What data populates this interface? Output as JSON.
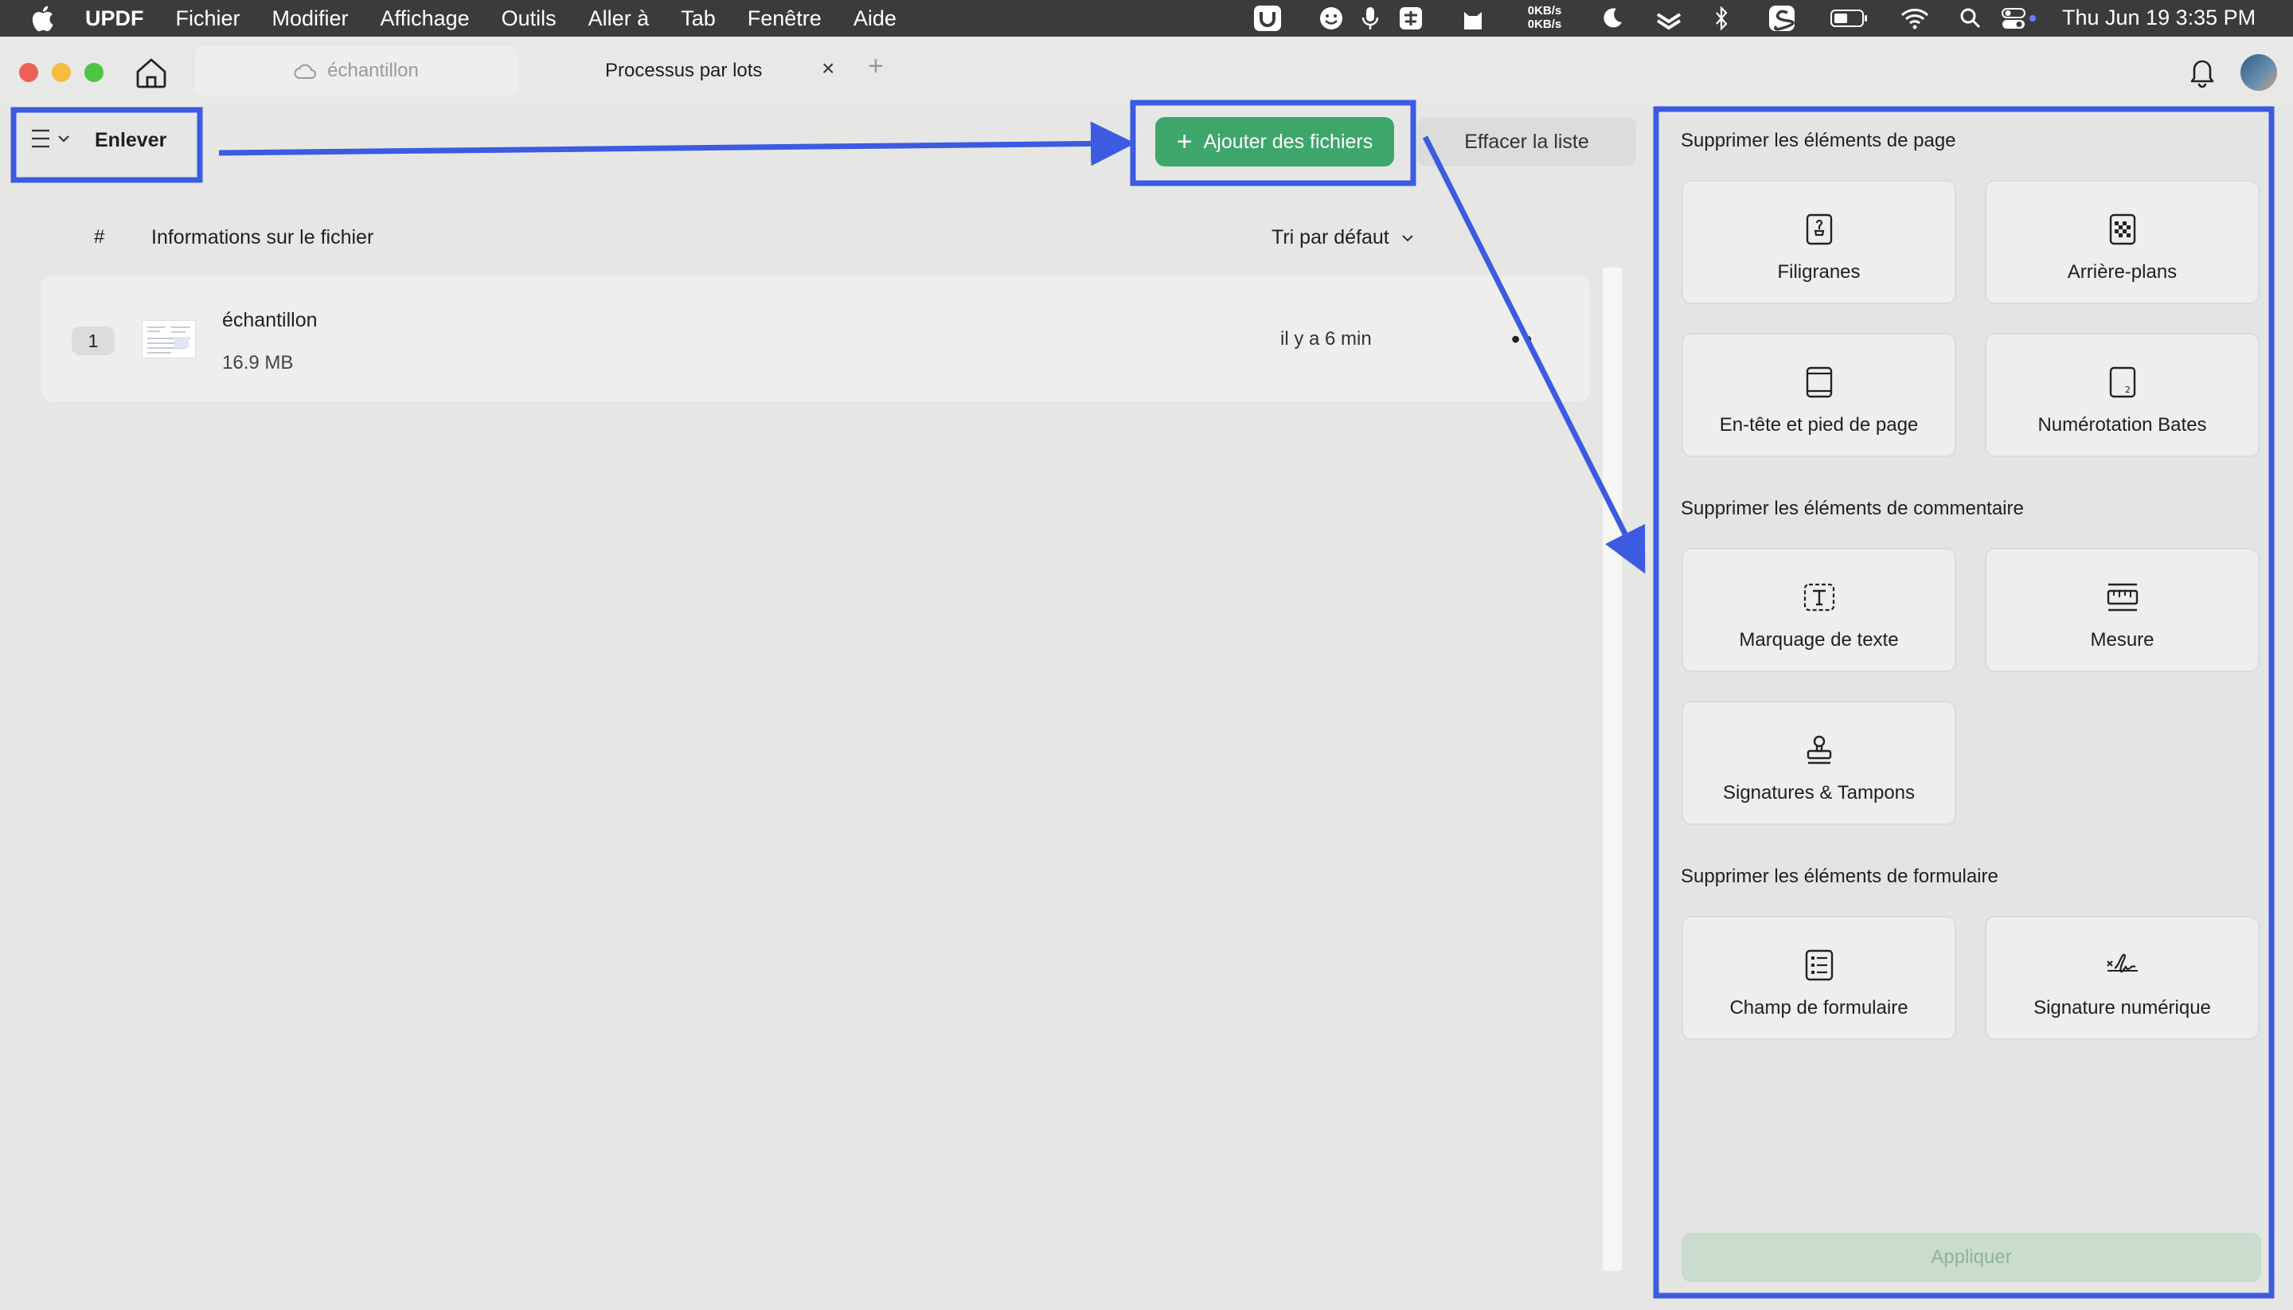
{
  "menubar": {
    "app_name": "UPDF",
    "menus": [
      "Fichier",
      "Modifier",
      "Affichage",
      "Outils",
      "Aller à",
      "Tab",
      "Fenêtre",
      "Aide"
    ],
    "net_up": "0KB/s",
    "net_down": "0KB/s",
    "clock": "Thu Jun 19  3:35 PM"
  },
  "tabs": [
    {
      "label": "échantillon",
      "icon": "cloud-icon"
    },
    {
      "label": "Processus par lots",
      "close": "×"
    }
  ],
  "new_tab": "+",
  "toolbar": {
    "mode_label": "Enlever",
    "add_files": "Ajouter des fichiers",
    "add_plus": "+",
    "clear_list": "Effacer la liste"
  },
  "list": {
    "col_index": "#",
    "col_info": "Informations sur le fichier",
    "sort_label": "Tri par défaut",
    "files": [
      {
        "index": "1",
        "name": "échantillon",
        "size": "16.9 MB",
        "time": "il y a 6 min",
        "more": "••"
      }
    ]
  },
  "panel": {
    "sections": [
      {
        "title": "Supprimer les éléments de page",
        "items": [
          {
            "label": "Filigranes",
            "icon": "watermark-icon"
          },
          {
            "label": "Arrière-plans",
            "icon": "background-icon"
          },
          {
            "label": "En-tête et pied de page",
            "icon": "header-footer-icon"
          },
          {
            "label": "Numérotation Bates",
            "icon": "bates-numbering-icon"
          }
        ]
      },
      {
        "title": "Supprimer les éléments de commentaire",
        "items": [
          {
            "label": "Marquage de texte",
            "icon": "text-markup-icon"
          },
          {
            "label": "Mesure",
            "icon": "measure-icon"
          },
          {
            "label": "Signatures & Tampons",
            "icon": "stamp-icon"
          }
        ]
      },
      {
        "title": "Supprimer les éléments de formulaire",
        "items": [
          {
            "label": "Champ de formulaire",
            "icon": "form-field-icon"
          },
          {
            "label": "Signature numérique",
            "icon": "digital-signature-icon"
          }
        ]
      }
    ],
    "apply": "Appliquer"
  },
  "colors": {
    "accent_green": "#3ea66b",
    "annotation_blue": "#3d5be0",
    "menubar_bg": "#3a3b3c"
  }
}
